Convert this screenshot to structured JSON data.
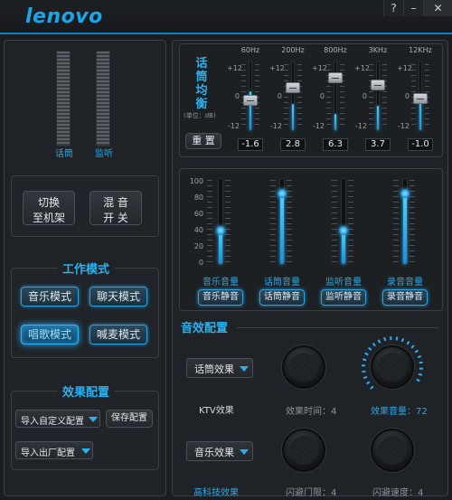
{
  "app": {
    "brand": "lenovo",
    "help_btn": "?",
    "min_btn": "–",
    "close_btn": "✕"
  },
  "colors": {
    "accent": "#19a7ec",
    "glow": "#34b6f4",
    "bg": "#1b1d20"
  },
  "meters": {
    "mic_label": "话筒",
    "monitor_label": "监听"
  },
  "switch": {
    "line1": "切换",
    "line2": "至机架",
    "mix_line1": "混 音",
    "mix_line2": "开 关"
  },
  "work_mode": {
    "title": "工作模式",
    "modes": [
      "音乐模式",
      "聊天模式",
      "唱歌模式",
      "喊麦模式"
    ],
    "active": "唱歌模式"
  },
  "effect_cfg": {
    "title": "效果配置",
    "import_custom": "导入自定义配置",
    "save": "保存配置",
    "import_factory": "导入出厂配置"
  },
  "eq": {
    "title_chars": [
      "话",
      "筒",
      "均",
      "衡"
    ],
    "unit": "(单位：dB)",
    "reset": "重 置",
    "scale": [
      "+12",
      "0",
      "-12"
    ],
    "bands": [
      {
        "freq": "60Hz",
        "value": "-1.6",
        "level": 0.43
      },
      {
        "freq": "200Hz",
        "value": "2.8",
        "level": 0.62
      },
      {
        "freq": "800Hz",
        "value": "6.3",
        "level": 0.76
      },
      {
        "freq": "3KHz",
        "value": "3.7",
        "level": 0.65
      },
      {
        "freq": "12KHz",
        "value": "-1.0",
        "level": 0.46
      }
    ]
  },
  "volume": {
    "scale": [
      "100",
      "80",
      "60",
      "40",
      "20",
      "0"
    ],
    "channels": [
      {
        "label": "音乐音量",
        "mute": "音乐静音",
        "level": 0.4
      },
      {
        "label": "话筒音量",
        "mute": "话筒静音",
        "level": 0.82
      },
      {
        "label": "监听音量",
        "mute": "监听静音",
        "level": 0.4
      },
      {
        "label": "录音音量",
        "mute": "录音静音",
        "level": 0.82
      }
    ]
  },
  "sound_cfg": {
    "title": "音效配置",
    "mic_effect": "话筒效果",
    "mic_effect_sub": "KTV效果",
    "music_effect": "音乐效果",
    "music_effect_sub": "高科技效果",
    "effect_time": "效果时间：4",
    "effect_volume": "效果音量：72",
    "flash_threshold": "闪避门限：4",
    "flash_speed": "闪避速度：4"
  }
}
